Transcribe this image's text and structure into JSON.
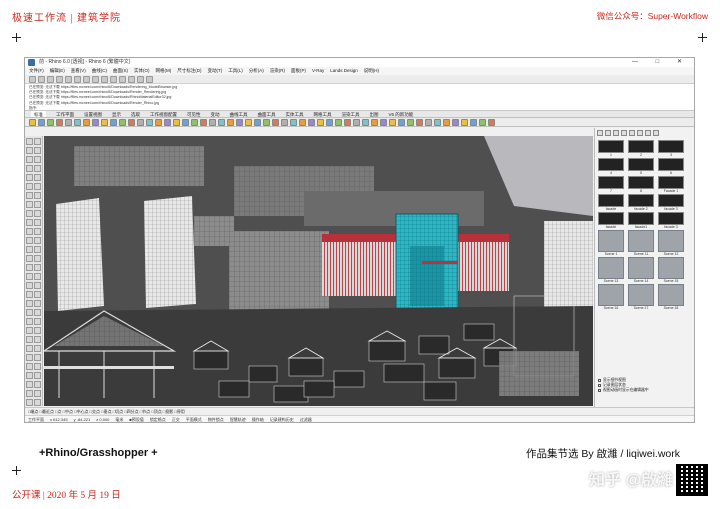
{
  "page": {
    "header_left": "极速工作流 | 建筑学院",
    "header_right": "微信公众号：Super-Workflow",
    "caption_left": "+Rhino/Grasshopper +",
    "caption_right": "作品集节选 By 啟濰 / liqiwei.work",
    "footer_left": "公开课 | 2020 年 5 月 19 日",
    "watermark": "知乎 @啟濰"
  },
  "app": {
    "title": "前 - Rhino 6.0 [透视] - Rhino 6 (繁體中文)",
    "window_controls": "— □ ✕",
    "menus": [
      "文件(F)",
      "编辑(E)",
      "查看(V)",
      "曲线(C)",
      "曲面(S)",
      "实体(O)",
      "网格(M)",
      "尺寸标注(D)",
      "变动(T)",
      "工具(L)",
      "分析(A)",
      "渲染(R)",
      "面板(P)",
      "V-Ray",
      "Lands Design",
      "说明(H)"
    ],
    "command_history": [
      "已在预览: 无法下载 https://files.mcneel.com/rhino/6/Downloads/Rendering_ModelBrowser.jpg",
      "已在预览: 无法下载 https://files.mcneel.com/rhino/6/Downloads/Render_Rendering.jpg",
      "已在预览: 无法下载 https://files.mcneel.com/rhino/6/Downloads/RhinoMaterialEditor32.jpg",
      "已在预览: 无法下载 https://files.mcneel.com/rhino/6/Downloads/Render_Rhino.jpg",
      "指令:"
    ],
    "tabs": [
      "标准",
      "工作平面",
      "设置视图",
      "显示",
      "选取",
      "工作视窗配置",
      "可见性",
      "变动",
      "曲线工具",
      "曲面工具",
      "实体工具",
      "网格工具",
      "渲染工具",
      "出图",
      "V6 的新功能"
    ],
    "active_tab": "标准",
    "status_snaps": "□端点  □最近点  □点  □中点  □中心点  □交点  □垂点  □切点  □四分点  □节点  □顶点  □投影  □停用",
    "status_bar": [
      "工作平面",
      "x 612.345",
      "y -84.221",
      "z 0.000",
      "毫米",
      "■预设值",
      "锁定格点",
      "正交",
      "平面模式",
      "物件锁点",
      "智慧轨迹",
      "操作轴",
      "记录建构历史",
      "过滤器"
    ]
  },
  "panel": {
    "materials": [
      {
        "label": "1",
        "tone": "dark"
      },
      {
        "label": "2",
        "tone": "dark"
      },
      {
        "label": "3",
        "tone": "dark"
      },
      {
        "label": "4",
        "tone": "dark"
      },
      {
        "label": "5",
        "tone": "dark"
      },
      {
        "label": "6",
        "tone": "dark"
      },
      {
        "label": "7",
        "tone": "dark"
      },
      {
        "label": "8",
        "tone": "dark"
      },
      {
        "label": "Facade 1",
        "tone": "dark"
      },
      {
        "label": "facade",
        "tone": "dark"
      },
      {
        "label": "facade 2",
        "tone": "dark"
      },
      {
        "label": "facade 3",
        "tone": "dark"
      },
      {
        "label": "facade",
        "tone": "dark"
      },
      {
        "label": "facade1",
        "tone": "dark"
      },
      {
        "label": "facade 3",
        "tone": "dark"
      },
      {
        "label": "Scene 1",
        "tone": "grey"
      },
      {
        "label": "Scene 11",
        "tone": "grey"
      },
      {
        "label": "Scene 12",
        "tone": "grey"
      },
      {
        "label": "Scene 13",
        "tone": "grey"
      },
      {
        "label": "Scene 14",
        "tone": "grey"
      },
      {
        "label": "Scene 15",
        "tone": "grey"
      },
      {
        "label": "Scene 16",
        "tone": "grey"
      },
      {
        "label": "Scene 17",
        "tone": "grey"
      },
      {
        "label": "Scene 18",
        "tone": "grey"
      }
    ],
    "options": [
      "显示细节视图",
      "记录图层状态",
      "视图动画时显示在编辑器中"
    ]
  },
  "colors": {
    "accent_red": "#c8281e",
    "viewport_bg": "#4a4a4a",
    "highlight_cyan": "#27b8c8",
    "highlight_red": "#c0303a"
  }
}
